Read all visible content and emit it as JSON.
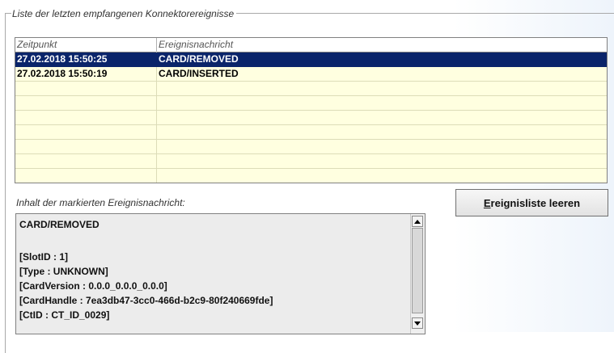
{
  "group": {
    "legend": "Liste der letzten empfangenen Konnektorereignisse"
  },
  "table": {
    "columns": [
      "Zeitpunkt",
      "Ereignisnachricht"
    ],
    "rows": [
      {
        "time": "27.02.2018 15:50:25",
        "message": "CARD/REMOVED",
        "selected": true
      },
      {
        "time": "27.02.2018 15:50:19",
        "message": "CARD/INSERTED",
        "selected": false
      }
    ],
    "selection_color": "#0a246a",
    "row_color": "#ffffe0"
  },
  "detail": {
    "label": "Inhalt der markierten Ereignisnachricht:",
    "lines": [
      "CARD/REMOVED",
      "",
      "[SlotID : 1]",
      "[Type : UNKNOWN]",
      "[CardVersion : 0.0.0_0.0.0_0.0.0]",
      "[CardHandle : 7ea3db47-3cc0-466d-b2c9-80f240669fde]",
      "[CtID : CT_ID_0029]"
    ]
  },
  "button": {
    "clear_mnemonic": "E",
    "clear_rest": "reignisliste leeren"
  }
}
